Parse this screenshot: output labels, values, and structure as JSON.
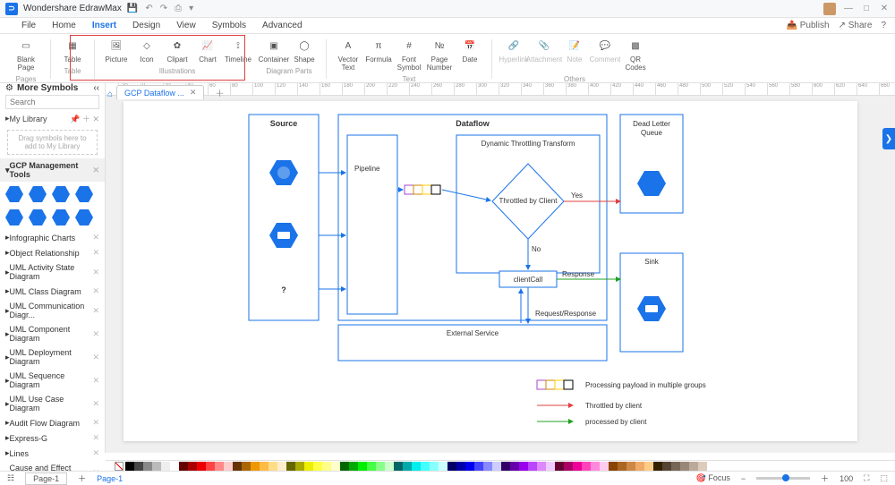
{
  "app": {
    "title": "Wondershare EdrawMax"
  },
  "titlebar": {
    "publish": "Publish",
    "share": "Share"
  },
  "menu": {
    "items": [
      "File",
      "Home",
      "Insert",
      "Design",
      "View",
      "Symbols",
      "Advanced"
    ],
    "active": "Insert"
  },
  "ribbon": {
    "pages": {
      "blank": "Blank\nPage",
      "label": "Pages"
    },
    "table": {
      "table": "Table",
      "label": "Table"
    },
    "illus": {
      "picture": "Picture",
      "icon": "Icon",
      "clipart": "Clipart",
      "chart": "Chart",
      "timeline": "Timeline",
      "label": "Illustrations"
    },
    "parts": {
      "container": "Container",
      "shape": "Shape",
      "label": "Diagram Parts"
    },
    "text": {
      "vector": "Vector\nText",
      "formula": "Formula",
      "font": "Font\nSymbol",
      "page": "Page\nNumber",
      "date": "Date",
      "label": "Text"
    },
    "others": {
      "hyper": "Hyperlink",
      "attach": "Attachment",
      "note": "Note",
      "comm": "Comment",
      "qr": "QR\nCodes",
      "label": "Others"
    }
  },
  "filetab": {
    "name": "GCP Dataflow ..."
  },
  "left": {
    "more": "More Symbols",
    "search_ph": "Search",
    "mylib": "My Library",
    "draghint": "Drag symbols here to add to My Library",
    "gcp": "GCP Management Tools",
    "cats": [
      "Infographic Charts",
      "Object Relationship",
      "UML Activity State Diagram",
      "UML Class Diagram",
      "UML Communication Diagr...",
      "UML Component Diagram",
      "UML Deployment Diagram",
      "UML Sequence Diagram",
      "UML Use Case Diagram",
      "Audit Flow Diagram",
      "Express-G",
      "Lines",
      "Cause and Effect Diagram"
    ]
  },
  "diagram": {
    "source": "Source",
    "dataflow": "Dataflow",
    "dlq": "Dead Letter\nQueue",
    "sink": "Sink",
    "pipeline": "Pipeline",
    "dyn": "Dynamic Throttling Transform",
    "throttled": "Throttled by Client",
    "yes": "Yes",
    "no": "No",
    "clientcall": "clientCall",
    "response": "Response",
    "reqresp": "Request/Response",
    "ext": "External Service",
    "q": "?",
    "legend1": "Processing payload in multiple groups",
    "legend2": "Throttled by client",
    "legend3": "processed by client"
  },
  "statusbar": {
    "page": "Page-1",
    "pagelabel": "Page-1",
    "focus": "Focus",
    "zoom": "100"
  },
  "colors": [
    "#000",
    "#444",
    "#888",
    "#bbb",
    "#eee",
    "#fff",
    "#600",
    "#a00",
    "#e00",
    "#f44",
    "#f88",
    "#fcc",
    "#630",
    "#a60",
    "#e90",
    "#fb4",
    "#fd8",
    "#fec",
    "#660",
    "#aa0",
    "#ee0",
    "#ff4",
    "#ff8",
    "#ffc",
    "#060",
    "#0a0",
    "#0e0",
    "#4f4",
    "#8f8",
    "#cfc",
    "#066",
    "#0aa",
    "#0ee",
    "#4ff",
    "#8ff",
    "#cff",
    "#006",
    "#00a",
    "#00e",
    "#44f",
    "#88f",
    "#ccf",
    "#306",
    "#60a",
    "#90e",
    "#b4f",
    "#d8f",
    "#ecf",
    "#603",
    "#a06",
    "#e09",
    "#f4b",
    "#f8d",
    "#fce",
    "#840",
    "#a62",
    "#c84",
    "#ea6",
    "#fc8",
    "#320",
    "#543",
    "#765",
    "#987",
    "#ba9",
    "#dcb"
  ]
}
